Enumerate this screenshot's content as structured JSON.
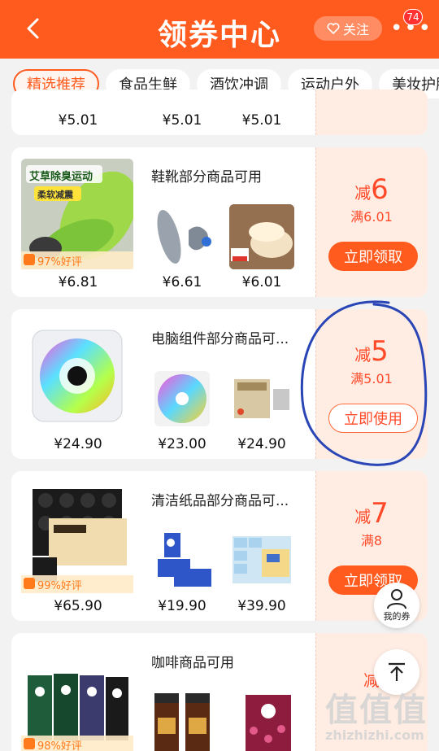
{
  "header": {
    "title": "领券中心",
    "follow_label": "关注",
    "badge_count": "74",
    "bg_color": "#ff5b1f"
  },
  "tabs": [
    {
      "label": "精选推荐",
      "active": true
    },
    {
      "label": "食品生鲜",
      "active": false
    },
    {
      "label": "酒饮冲调",
      "active": false
    },
    {
      "label": "运动户外",
      "active": false
    },
    {
      "label": "美妆护肤",
      "active": false
    }
  ],
  "partial_card": {
    "prices": [
      "¥5.01",
      "¥5.01",
      "¥5.01"
    ]
  },
  "cards": [
    {
      "title": "鞋靴部分商品可用",
      "main_price": "¥6.81",
      "review": "97%好评",
      "thumb_prices": [
        "¥6.61",
        "¥6.01"
      ],
      "reduce_prefix": "减",
      "reduce_amount": "6",
      "threshold": "满6.01",
      "button": "立即领取",
      "main_image_text": [
        "艾草除臭运动",
        "柔软减震"
      ]
    },
    {
      "title": "电脑组件部分商品可...",
      "main_price": "¥24.90",
      "review": "",
      "thumb_prices": [
        "¥23.00",
        "¥24.90"
      ],
      "reduce_prefix": "减",
      "reduce_amount": "5",
      "threshold": "满5.01",
      "button": "立即使用"
    },
    {
      "title": "清洁纸品部分商品可...",
      "main_price": "¥65.90",
      "review": "99%好评",
      "thumb_prices": [
        "¥19.90",
        "¥39.90"
      ],
      "reduce_prefix": "减",
      "reduce_amount": "7",
      "threshold": "满8",
      "button": "立即领取"
    },
    {
      "title": "咖啡商品可用",
      "main_price": "",
      "review": "98%好评",
      "thumb_prices": [],
      "reduce_prefix": "减",
      "reduce_amount": "",
      "threshold": "",
      "button": ""
    }
  ],
  "float": {
    "my_coupon_label": "我的券"
  },
  "watermark": {
    "big": "值值值",
    "small": "zhizhizhi.com"
  },
  "colors": {
    "accent": "#ff5b1f",
    "coupon_bg": "#ffede3",
    "annotation_circle": "#2a45b5"
  }
}
